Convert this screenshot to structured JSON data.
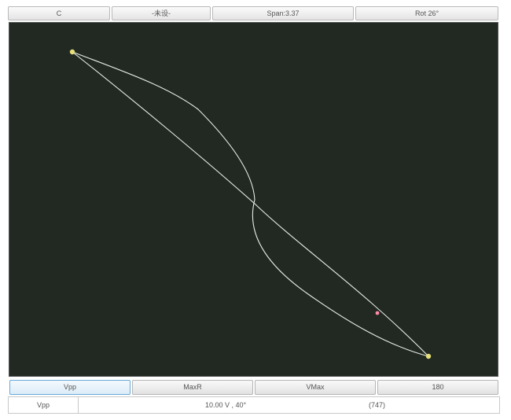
{
  "top_bar": {
    "buttons": [
      "C",
      "-未设-",
      "Span:3.37",
      "Rot 26°"
    ]
  },
  "bottom_bar": {
    "buttons": [
      "Vpp",
      "MaxR",
      "VMax",
      "180"
    ],
    "active_index": 0
  },
  "status": {
    "label": "Vpp",
    "value": "10.00 V , 40°",
    "count": "(747)"
  },
  "colors": {
    "plot_background": "#212922",
    "curve": "#e8ece6",
    "endpoint_marker": "#e6e07a",
    "cursor_marker": "#ff8aa8"
  },
  "icons": [
    "endpoint-marker-icon",
    "cursor-marker-icon"
  ]
}
